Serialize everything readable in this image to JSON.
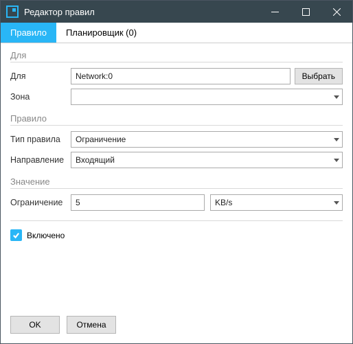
{
  "window": {
    "title": "Редактор правил"
  },
  "tabs": {
    "rule": "Правило",
    "scheduler": "Планировщик (0)"
  },
  "sections": {
    "for": "Для",
    "rule": "Правило",
    "value": "Значение"
  },
  "labels": {
    "for": "Для",
    "zone": "Зона",
    "rule_type": "Тип правила",
    "direction": "Направление",
    "limit": "Ограничение"
  },
  "values": {
    "for": "Network:0",
    "zone": "",
    "rule_type": "Ограничение",
    "direction": "Входящий",
    "limit": "5",
    "unit": "KB/s"
  },
  "buttons": {
    "select": "Выбрать",
    "ok": "OK",
    "cancel": "Отмена"
  },
  "checkbox": {
    "enabled": "Включено"
  }
}
